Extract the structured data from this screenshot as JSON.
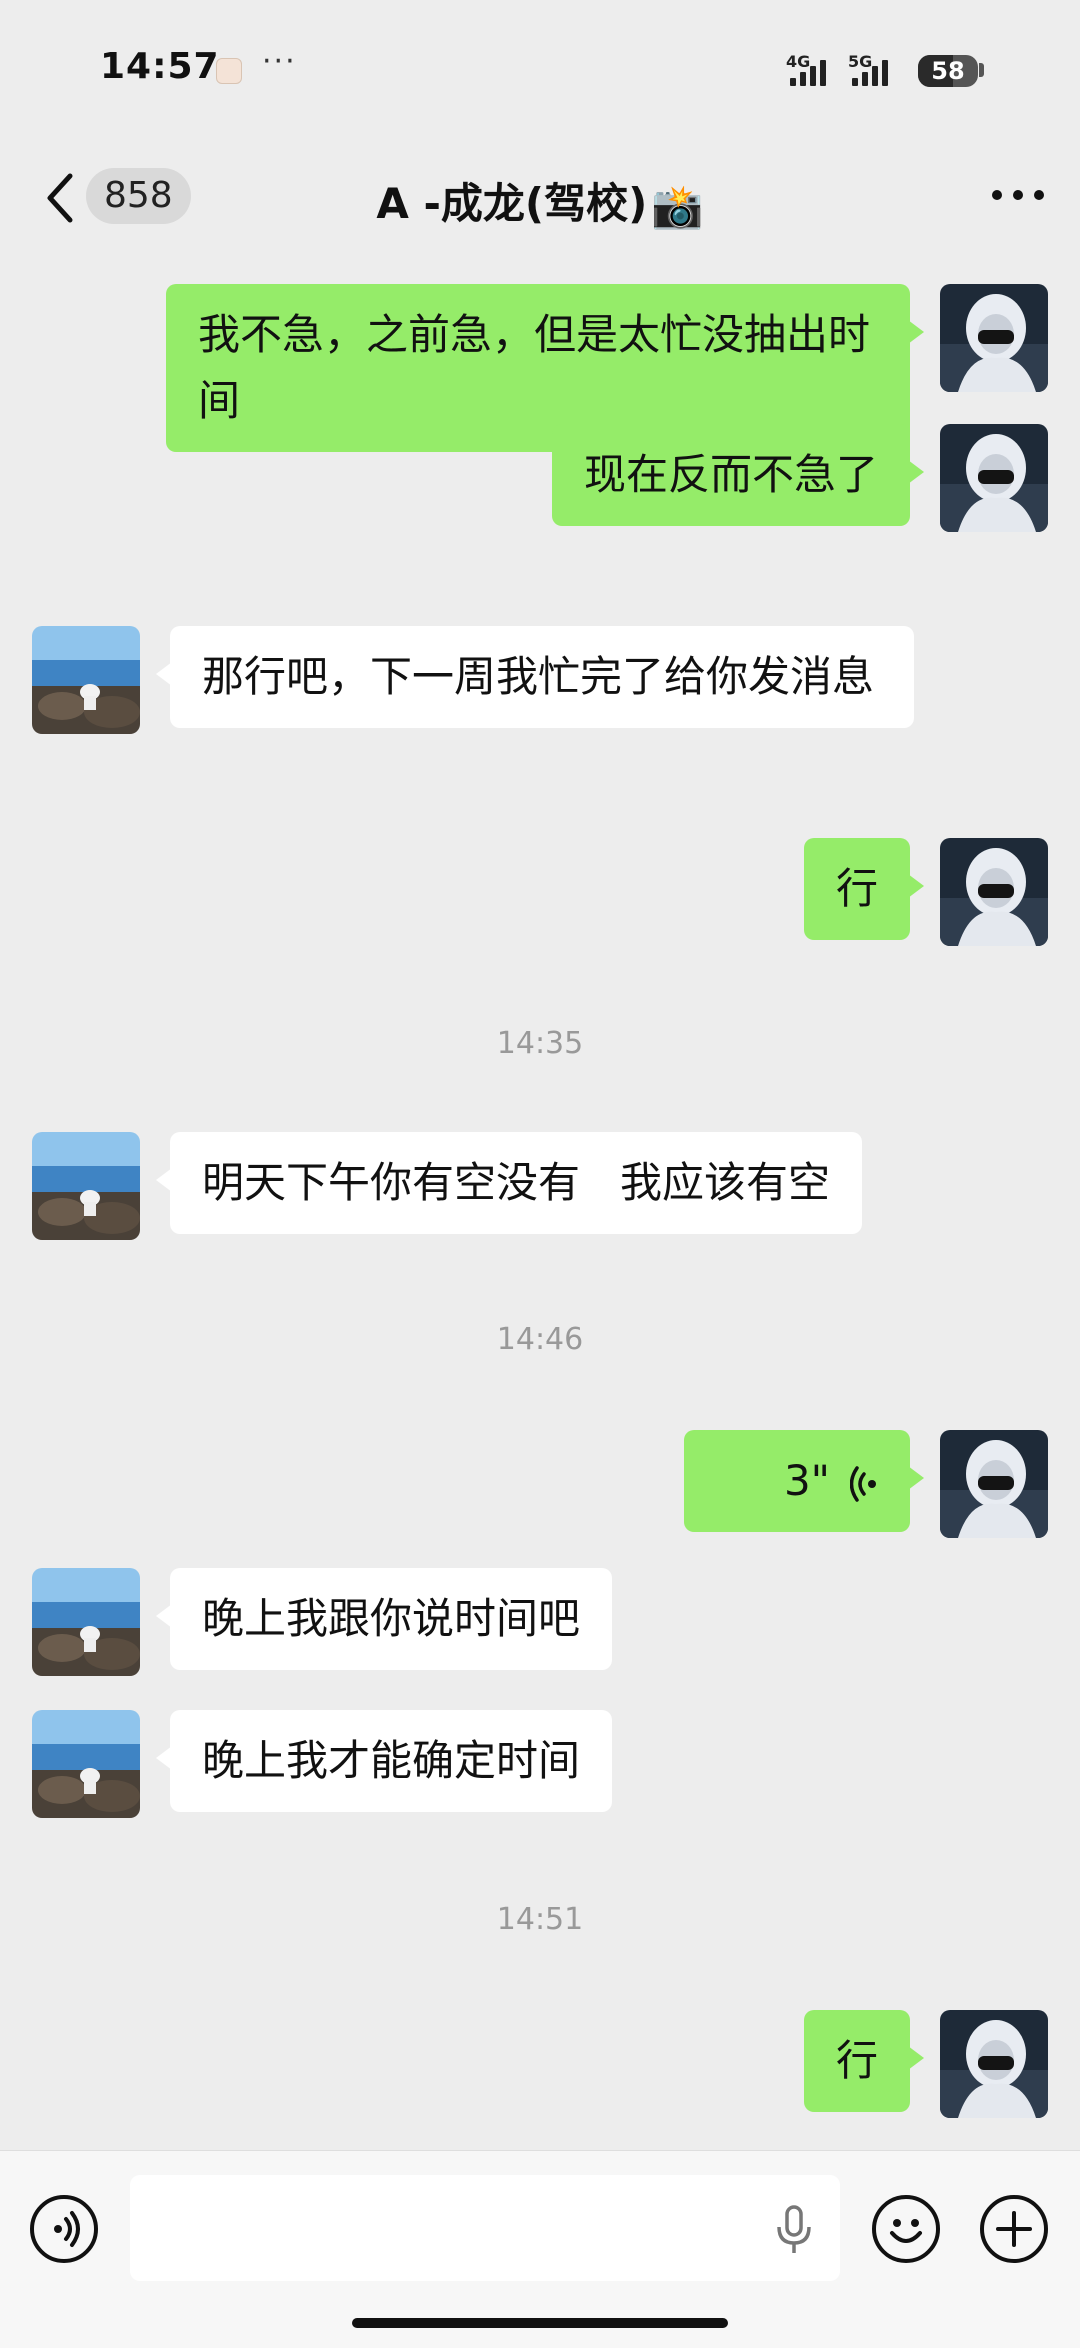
{
  "status_bar": {
    "time": "14:57",
    "dots": "···",
    "network_1": "4G",
    "network_2": "5G",
    "battery": "58",
    "battery_level": 0.58
  },
  "nav": {
    "unread_count": "858",
    "title": "A  -成龙(驾校)",
    "title_emoji": "📸"
  },
  "messages": [
    {
      "sender": "self",
      "text": "我不急，之前急，但是太忙没抽出时间"
    },
    {
      "sender": "self",
      "text": "现在反而不急了"
    },
    {
      "sender": "other",
      "text": "那行吧，下一周我忙完了给你发消息"
    },
    {
      "sender": "self",
      "text": "行"
    },
    {
      "type": "timestamp",
      "text": "14:35"
    },
    {
      "sender": "other",
      "text": "明天下午你有空没有   我应该有空"
    },
    {
      "type": "timestamp",
      "text": "14:46"
    },
    {
      "sender": "self",
      "type": "voice",
      "text": "3\""
    },
    {
      "sender": "other",
      "text": "晚上我跟你说时间吧"
    },
    {
      "sender": "other",
      "text": "晚上我才能确定时间"
    },
    {
      "type": "timestamp",
      "text": "14:51"
    },
    {
      "sender": "self",
      "text": "行"
    }
  ],
  "input_bar": {
    "placeholder": ""
  },
  "icons": {
    "voice_toggle": "voice-icon",
    "emoji": "emoji-icon",
    "plus": "plus-icon",
    "mic": "mic-icon"
  },
  "colors": {
    "self_bubble": "#95ec69",
    "other_bubble": "#ffffff",
    "background": "#ededed"
  }
}
